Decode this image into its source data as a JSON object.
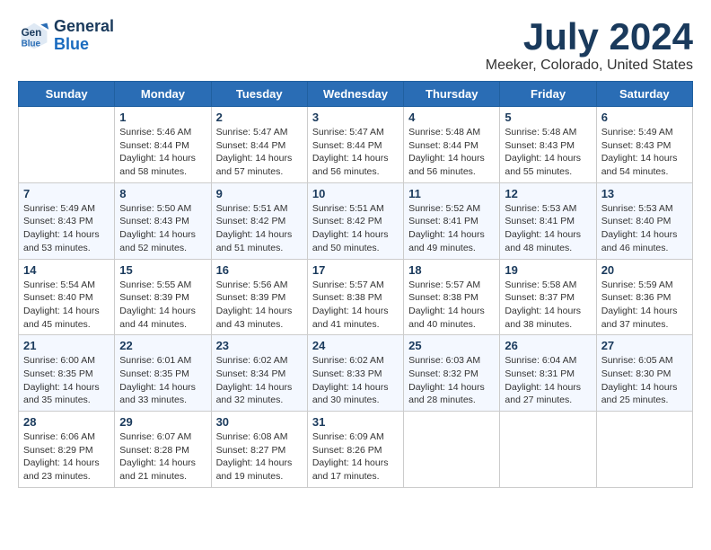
{
  "header": {
    "logo_line1": "General",
    "logo_line2": "Blue",
    "month": "July 2024",
    "location": "Meeker, Colorado, United States"
  },
  "days_of_week": [
    "Sunday",
    "Monday",
    "Tuesday",
    "Wednesday",
    "Thursday",
    "Friday",
    "Saturday"
  ],
  "weeks": [
    [
      {
        "day": "",
        "info": ""
      },
      {
        "day": "1",
        "info": "Sunrise: 5:46 AM\nSunset: 8:44 PM\nDaylight: 14 hours\nand 58 minutes."
      },
      {
        "day": "2",
        "info": "Sunrise: 5:47 AM\nSunset: 8:44 PM\nDaylight: 14 hours\nand 57 minutes."
      },
      {
        "day": "3",
        "info": "Sunrise: 5:47 AM\nSunset: 8:44 PM\nDaylight: 14 hours\nand 56 minutes."
      },
      {
        "day": "4",
        "info": "Sunrise: 5:48 AM\nSunset: 8:44 PM\nDaylight: 14 hours\nand 56 minutes."
      },
      {
        "day": "5",
        "info": "Sunrise: 5:48 AM\nSunset: 8:43 PM\nDaylight: 14 hours\nand 55 minutes."
      },
      {
        "day": "6",
        "info": "Sunrise: 5:49 AM\nSunset: 8:43 PM\nDaylight: 14 hours\nand 54 minutes."
      }
    ],
    [
      {
        "day": "7",
        "info": "Sunrise: 5:49 AM\nSunset: 8:43 PM\nDaylight: 14 hours\nand 53 minutes."
      },
      {
        "day": "8",
        "info": "Sunrise: 5:50 AM\nSunset: 8:43 PM\nDaylight: 14 hours\nand 52 minutes."
      },
      {
        "day": "9",
        "info": "Sunrise: 5:51 AM\nSunset: 8:42 PM\nDaylight: 14 hours\nand 51 minutes."
      },
      {
        "day": "10",
        "info": "Sunrise: 5:51 AM\nSunset: 8:42 PM\nDaylight: 14 hours\nand 50 minutes."
      },
      {
        "day": "11",
        "info": "Sunrise: 5:52 AM\nSunset: 8:41 PM\nDaylight: 14 hours\nand 49 minutes."
      },
      {
        "day": "12",
        "info": "Sunrise: 5:53 AM\nSunset: 8:41 PM\nDaylight: 14 hours\nand 48 minutes."
      },
      {
        "day": "13",
        "info": "Sunrise: 5:53 AM\nSunset: 8:40 PM\nDaylight: 14 hours\nand 46 minutes."
      }
    ],
    [
      {
        "day": "14",
        "info": "Sunrise: 5:54 AM\nSunset: 8:40 PM\nDaylight: 14 hours\nand 45 minutes."
      },
      {
        "day": "15",
        "info": "Sunrise: 5:55 AM\nSunset: 8:39 PM\nDaylight: 14 hours\nand 44 minutes."
      },
      {
        "day": "16",
        "info": "Sunrise: 5:56 AM\nSunset: 8:39 PM\nDaylight: 14 hours\nand 43 minutes."
      },
      {
        "day": "17",
        "info": "Sunrise: 5:57 AM\nSunset: 8:38 PM\nDaylight: 14 hours\nand 41 minutes."
      },
      {
        "day": "18",
        "info": "Sunrise: 5:57 AM\nSunset: 8:38 PM\nDaylight: 14 hours\nand 40 minutes."
      },
      {
        "day": "19",
        "info": "Sunrise: 5:58 AM\nSunset: 8:37 PM\nDaylight: 14 hours\nand 38 minutes."
      },
      {
        "day": "20",
        "info": "Sunrise: 5:59 AM\nSunset: 8:36 PM\nDaylight: 14 hours\nand 37 minutes."
      }
    ],
    [
      {
        "day": "21",
        "info": "Sunrise: 6:00 AM\nSunset: 8:35 PM\nDaylight: 14 hours\nand 35 minutes."
      },
      {
        "day": "22",
        "info": "Sunrise: 6:01 AM\nSunset: 8:35 PM\nDaylight: 14 hours\nand 33 minutes."
      },
      {
        "day": "23",
        "info": "Sunrise: 6:02 AM\nSunset: 8:34 PM\nDaylight: 14 hours\nand 32 minutes."
      },
      {
        "day": "24",
        "info": "Sunrise: 6:02 AM\nSunset: 8:33 PM\nDaylight: 14 hours\nand 30 minutes."
      },
      {
        "day": "25",
        "info": "Sunrise: 6:03 AM\nSunset: 8:32 PM\nDaylight: 14 hours\nand 28 minutes."
      },
      {
        "day": "26",
        "info": "Sunrise: 6:04 AM\nSunset: 8:31 PM\nDaylight: 14 hours\nand 27 minutes."
      },
      {
        "day": "27",
        "info": "Sunrise: 6:05 AM\nSunset: 8:30 PM\nDaylight: 14 hours\nand 25 minutes."
      }
    ],
    [
      {
        "day": "28",
        "info": "Sunrise: 6:06 AM\nSunset: 8:29 PM\nDaylight: 14 hours\nand 23 minutes."
      },
      {
        "day": "29",
        "info": "Sunrise: 6:07 AM\nSunset: 8:28 PM\nDaylight: 14 hours\nand 21 minutes."
      },
      {
        "day": "30",
        "info": "Sunrise: 6:08 AM\nSunset: 8:27 PM\nDaylight: 14 hours\nand 19 minutes."
      },
      {
        "day": "31",
        "info": "Sunrise: 6:09 AM\nSunset: 8:26 PM\nDaylight: 14 hours\nand 17 minutes."
      },
      {
        "day": "",
        "info": ""
      },
      {
        "day": "",
        "info": ""
      },
      {
        "day": "",
        "info": ""
      }
    ]
  ]
}
